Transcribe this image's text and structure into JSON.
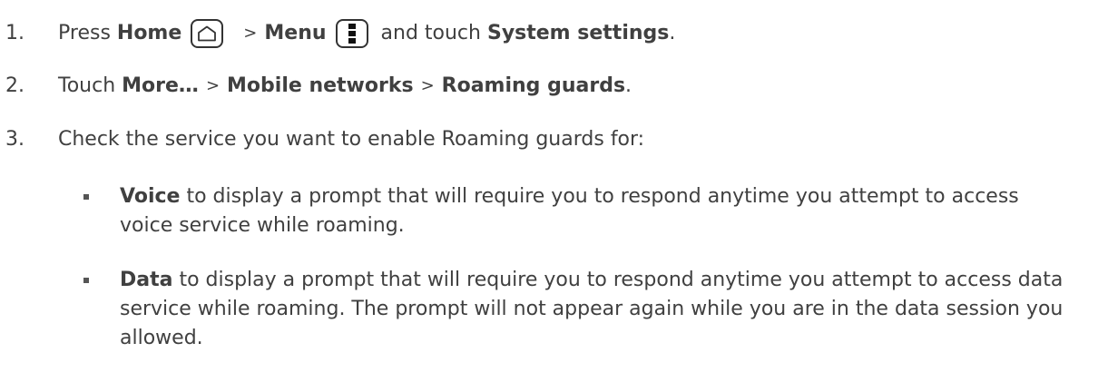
{
  "steps": [
    {
      "number": "1.",
      "press": "Press",
      "home": "Home",
      "sep1": ">",
      "menu": "Menu",
      "and_touch": "and touch",
      "system_settings": "System settings",
      "end": "."
    },
    {
      "number": "2.",
      "touch": "Touch",
      "more": "More…",
      "sep1": ">",
      "mobile_networks": "Mobile networks",
      "sep2": ">",
      "roaming_guards": "Roaming guards",
      "end": "."
    },
    {
      "number": "3.",
      "text": "Check the service you want to enable Roaming guards for:"
    }
  ],
  "bullets": [
    {
      "term": "Voice",
      "text": " to display a prompt that will require you to respond anytime you attempt to access voice service while roaming."
    },
    {
      "term": "Data",
      "text": " to display a prompt that will require you to respond anytime you attempt to access data service while roaming. The prompt will not appear again while you are in the data session you allowed."
    }
  ],
  "icons": {
    "home": "home-icon",
    "menu": "menu-icon"
  }
}
